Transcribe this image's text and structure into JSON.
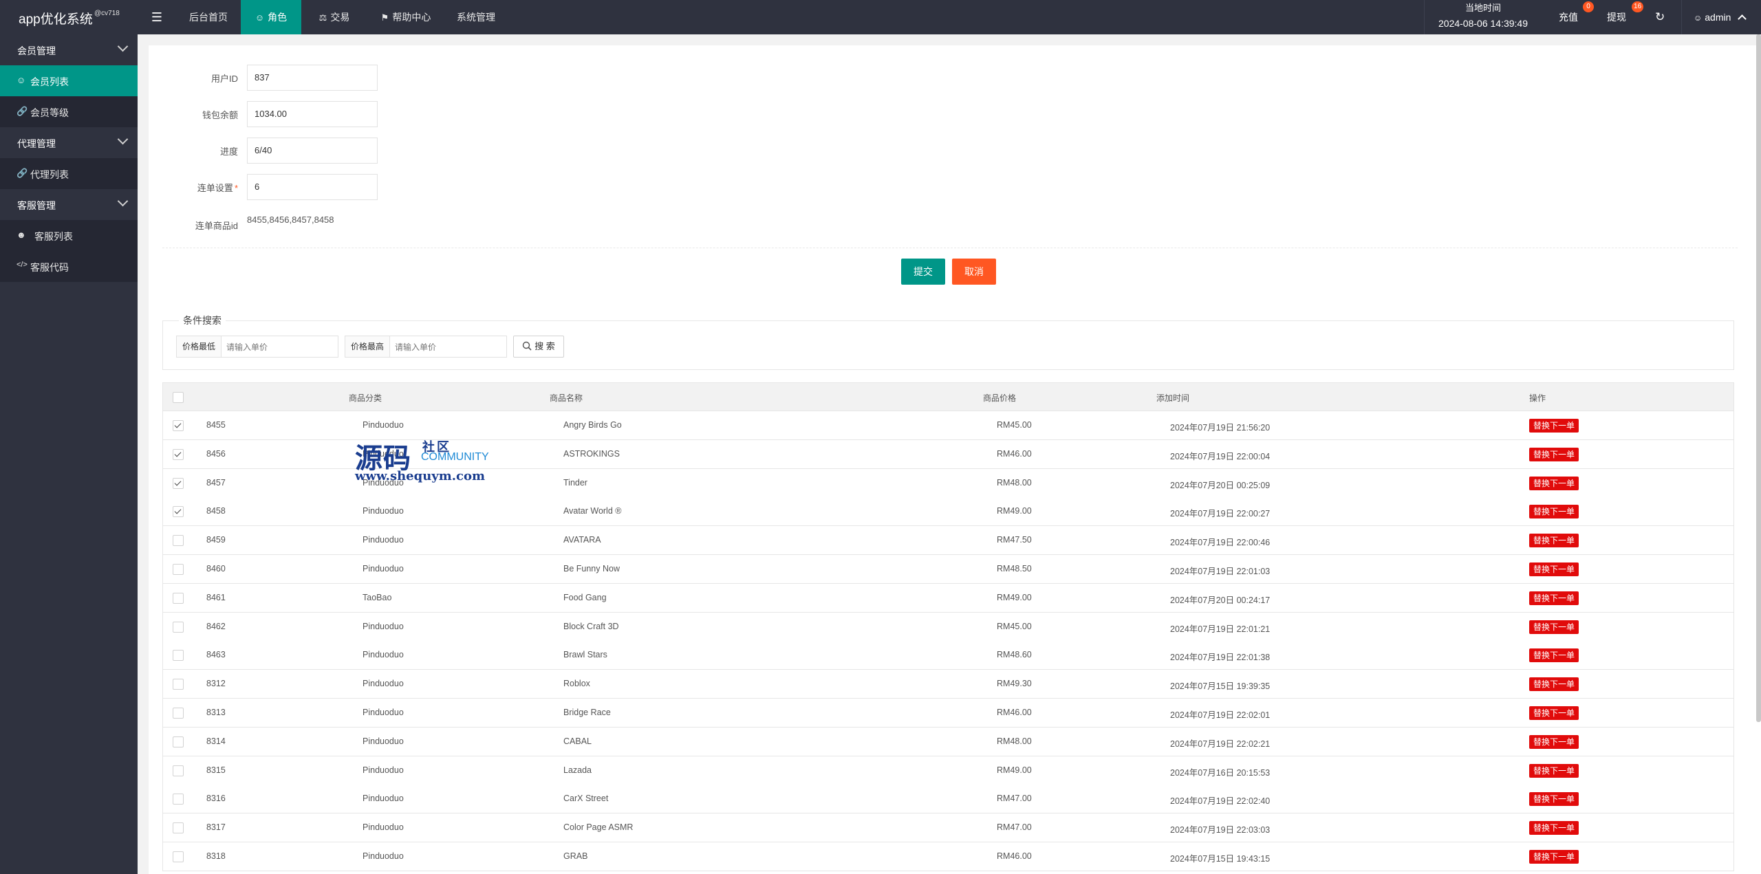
{
  "app": {
    "title": "app优化系统",
    "version": "@cv718"
  },
  "nav": {
    "tabs": [
      {
        "label": "后台首页",
        "icon": ""
      },
      {
        "label": "角色",
        "icon": "user-icon"
      },
      {
        "label": "交易",
        "icon": "scale-icon"
      },
      {
        "label": "帮助中心",
        "icon": "flag-icon"
      },
      {
        "label": "系统管理",
        "icon": ""
      }
    ],
    "active_tab": 1,
    "clock_label": "当地时间",
    "clock_value": "2024-08-06 14:39:49",
    "recharge_label": "充值",
    "recharge_badge": "0",
    "withdraw_label": "提现",
    "withdraw_badge": "16",
    "user_label": "admin"
  },
  "sidebar": {
    "groups": [
      {
        "label": "会员管理",
        "items": [
          {
            "label": "会员列表",
            "icon": "user-icon",
            "active": true
          },
          {
            "label": "会员等级",
            "icon": "link-icon"
          }
        ]
      },
      {
        "label": "代理管理",
        "items": [
          {
            "label": "代理列表",
            "icon": "link-icon"
          }
        ]
      },
      {
        "label": "客服管理",
        "items": [
          {
            "label": "客服列表",
            "icon": "users-icon"
          },
          {
            "label": "客服代码",
            "icon": "code-icon"
          }
        ]
      }
    ]
  },
  "form": {
    "user_id_label": "用户ID",
    "user_id_value": "837",
    "balance_label": "钱包余额",
    "balance_value": "1034.00",
    "progress_label": "进度",
    "progress_value": "6/40",
    "chain_label": "连单设置",
    "chain_value": "6",
    "chain_ids_label": "连单商品id",
    "chain_ids_value": "8455,8456,8457,8458",
    "submit_label": "提交",
    "cancel_label": "取消"
  },
  "search": {
    "legend": "条件搜索",
    "min_label": "价格最低",
    "min_placeholder": "请输入单价",
    "max_label": "价格最高",
    "max_placeholder": "请输入单价",
    "button_label": "搜 索"
  },
  "table": {
    "headers": [
      "商品分类",
      "商品名称",
      "商品价格",
      "添加时间",
      "操作"
    ],
    "action_label": "替换下一单",
    "rows": [
      {
        "id": "8455",
        "category": "Pinduoduo",
        "name": "Angry Birds Go",
        "price": "RM45.00",
        "time": "2024年07月19日 21:56:20",
        "checked": true
      },
      {
        "id": "8456",
        "category": "Pinduoduo",
        "name": "ASTROKINGS",
        "price": "RM46.00",
        "time": "2024年07月19日 22:00:04",
        "checked": true
      },
      {
        "id": "8457",
        "category": "Pinduoduo",
        "name": "Tinder",
        "price": "RM48.00",
        "time": "2024年07月20日 00:25:09",
        "checked": true
      },
      {
        "id": "8458",
        "category": "Pinduoduo",
        "name": "Avatar World ®",
        "price": "RM49.00",
        "time": "2024年07月19日 22:00:27",
        "checked": true
      },
      {
        "id": "8459",
        "category": "Pinduoduo",
        "name": "AVATARA",
        "price": "RM47.50",
        "time": "2024年07月19日 22:00:46",
        "checked": false
      },
      {
        "id": "8460",
        "category": "Pinduoduo",
        "name": "Be Funny Now",
        "price": "RM48.50",
        "time": "2024年07月19日 22:01:03",
        "checked": false
      },
      {
        "id": "8461",
        "category": "TaoBao",
        "name": "Food Gang",
        "price": "RM49.00",
        "time": "2024年07月20日 00:24:17",
        "checked": false
      },
      {
        "id": "8462",
        "category": "Pinduoduo",
        "name": "Block Craft 3D",
        "price": "RM45.00",
        "time": "2024年07月19日 22:01:21",
        "checked": false
      },
      {
        "id": "8463",
        "category": "Pinduoduo",
        "name": "Brawl Stars",
        "price": "RM48.60",
        "time": "2024年07月19日 22:01:38",
        "checked": false
      },
      {
        "id": "8312",
        "category": "Pinduoduo",
        "name": "Roblox",
        "price": "RM49.30",
        "time": "2024年07月15日 19:39:35",
        "checked": false
      },
      {
        "id": "8313",
        "category": "Pinduoduo",
        "name": "Bridge Race",
        "price": "RM46.00",
        "time": "2024年07月19日 22:02:01",
        "checked": false
      },
      {
        "id": "8314",
        "category": "Pinduoduo",
        "name": "CABAL",
        "price": "RM48.00",
        "time": "2024年07月19日 22:02:21",
        "checked": false
      },
      {
        "id": "8315",
        "category": "Pinduoduo",
        "name": "Lazada",
        "price": "RM49.00",
        "time": "2024年07月16日 20:15:53",
        "checked": false
      },
      {
        "id": "8316",
        "category": "Pinduoduo",
        "name": "CarX Street",
        "price": "RM47.00",
        "time": "2024年07月19日 22:02:40",
        "checked": false
      },
      {
        "id": "8317",
        "category": "Pinduoduo",
        "name": "Color Page ASMR",
        "price": "RM47.00",
        "time": "2024年07月19日 22:03:03",
        "checked": false
      },
      {
        "id": "8318",
        "category": "Pinduoduo",
        "name": "GRAB",
        "price": "RM46.00",
        "time": "2024年07月15日 19:43:15",
        "checked": false
      }
    ]
  },
  "watermark": {
    "big": "源码",
    "cn": "社区",
    "en": "COMMUNITY",
    "url": "www.shequym.com"
  },
  "colors": {
    "accent": "#009688",
    "warn": "#ff5722",
    "danger": "#e10b0b",
    "dark": "#2f323f"
  }
}
